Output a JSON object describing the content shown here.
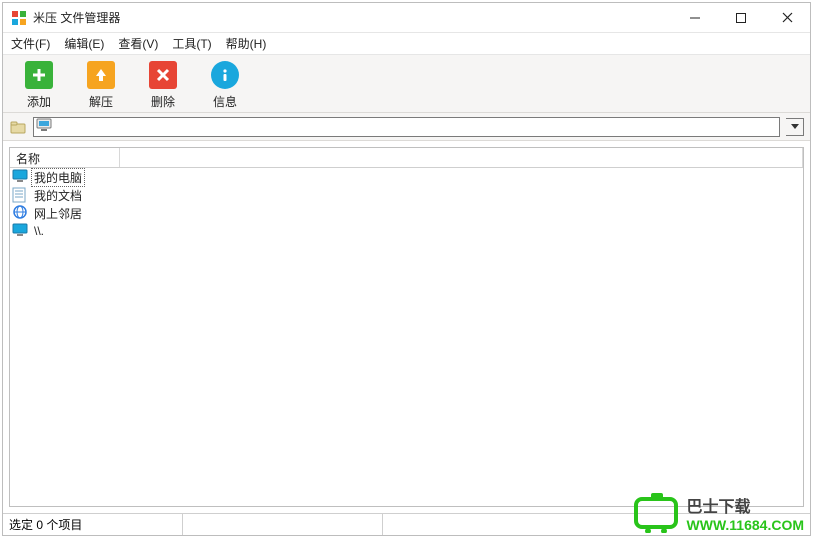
{
  "window": {
    "title": "米压 文件管理器"
  },
  "menu": {
    "file": "文件(F)",
    "edit": "编辑(E)",
    "view": "查看(V)",
    "tools": "工具(T)",
    "help": "帮助(H)"
  },
  "toolbar": {
    "add": {
      "label": "添加",
      "color": "#39b23a"
    },
    "extract": {
      "label": "解压",
      "color": "#f6a420"
    },
    "delete": {
      "label": "删除",
      "color": "#e74535"
    },
    "info": {
      "label": "信息",
      "color": "#1aa7dd"
    }
  },
  "pathbar": {
    "icon": "computer",
    "value": ""
  },
  "columns": {
    "name": "名称"
  },
  "files": [
    {
      "icon": "monitor",
      "color": "#1aa7dd",
      "label": "我的电脑",
      "selected": true
    },
    {
      "icon": "doc",
      "color": "#1aa7dd",
      "label": "我的文档",
      "selected": false
    },
    {
      "icon": "network",
      "color": "#2f7de1",
      "label": "网上邻居",
      "selected": false
    },
    {
      "icon": "monitor",
      "color": "#1aa7dd",
      "label": "\\\\.",
      "selected": false
    }
  ],
  "status": {
    "selection": "选定 0 个项目"
  },
  "watermark": {
    "brand_cn": "巴士下载",
    "url": "WWW.11684.COM"
  }
}
